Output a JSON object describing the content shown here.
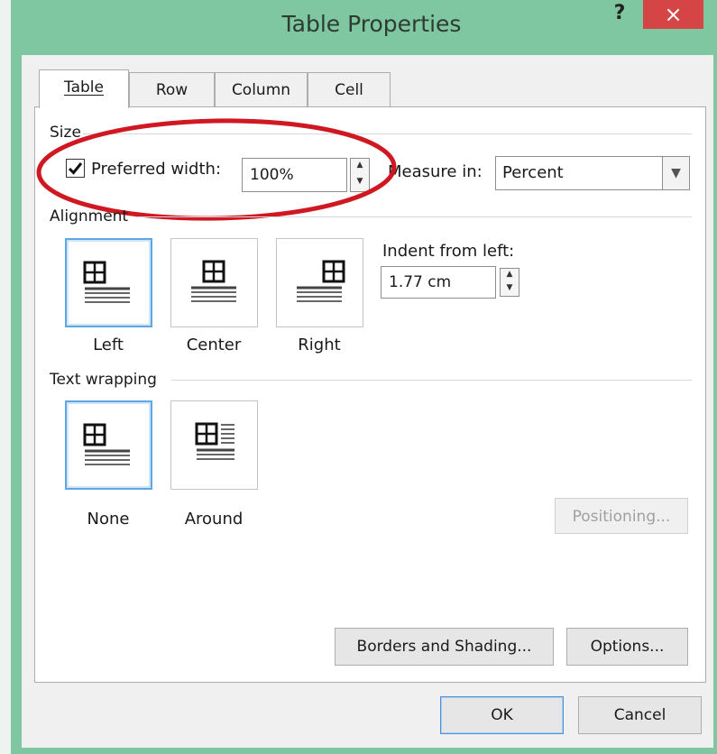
{
  "window": {
    "title": "Table Properties",
    "help_label": "?",
    "close_label": "×"
  },
  "tabs": [
    {
      "label": "Table",
      "active": true
    },
    {
      "label": "Row",
      "active": false
    },
    {
      "label": "Column",
      "active": false
    },
    {
      "label": "Cell",
      "active": false
    }
  ],
  "size": {
    "group_label": "Size",
    "preferred_width_label": "Preferred width:",
    "preferred_width_checked": true,
    "width_value": "100%",
    "measure_label": "Measure in:",
    "measure_value": "Percent"
  },
  "alignment": {
    "group_label": "Alignment",
    "options": [
      "Left",
      "Center",
      "Right"
    ],
    "selected": "Left",
    "indent_label": "Indent from left:",
    "indent_value": "1.77 cm"
  },
  "text_wrapping": {
    "group_label": "Text wrapping",
    "options": [
      "None",
      "Around"
    ],
    "selected": "None",
    "positioning_label": "Positioning..."
  },
  "buttons": {
    "borders_shading": "Borders and Shading...",
    "options": "Options...",
    "ok": "OK",
    "cancel": "Cancel"
  },
  "annotation": {
    "highlight_color": "#d01822"
  }
}
